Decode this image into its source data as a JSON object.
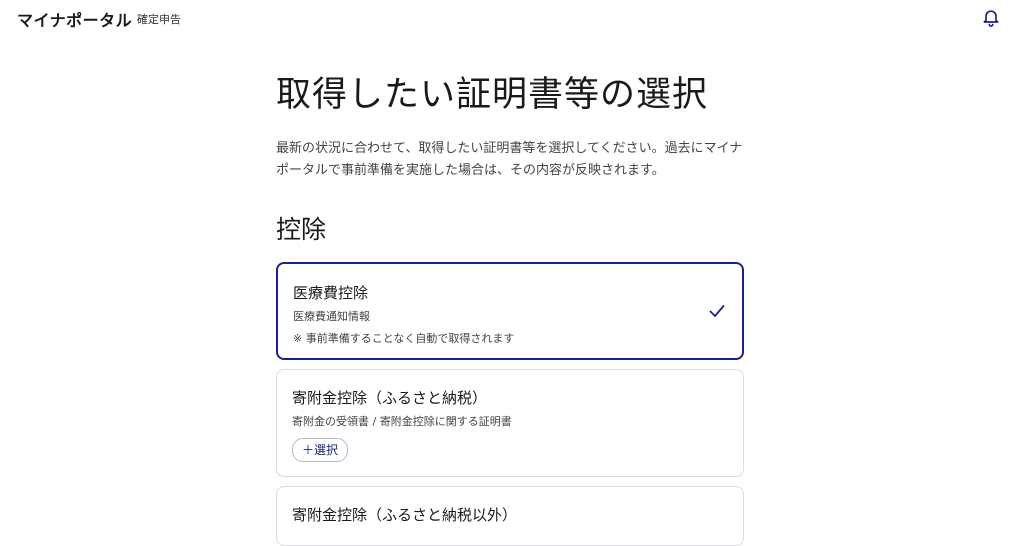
{
  "header": {
    "brand": "マイナポータル",
    "subtitle": "確定申告",
    "notification_icon": "bell-icon"
  },
  "main": {
    "title": "取得したい証明書等の選択",
    "description": "最新の状況に合わせて、取得したい証明書等を選択してください。過去にマイナポータルで事前準備を実施した場合は、その内容が反映されます。",
    "section_title": "控除",
    "cards": [
      {
        "title": "医療費控除",
        "subtitle": "医療費通知情報",
        "note": "※ 事前準備することなく自動で取得されます",
        "selected": true,
        "icon": "check-icon"
      },
      {
        "title": "寄附金控除（ふるさと納税）",
        "subtitle": "寄附金の受領書 / 寄附金控除に関する証明書",
        "button_label": "＋選択",
        "selected": false
      },
      {
        "title": "寄附金控除（ふるさと納税以外）",
        "selected": false
      }
    ]
  },
  "colors": {
    "accent": "#1d2088",
    "border": "#dcdce0",
    "text": "#1a1a1c"
  }
}
